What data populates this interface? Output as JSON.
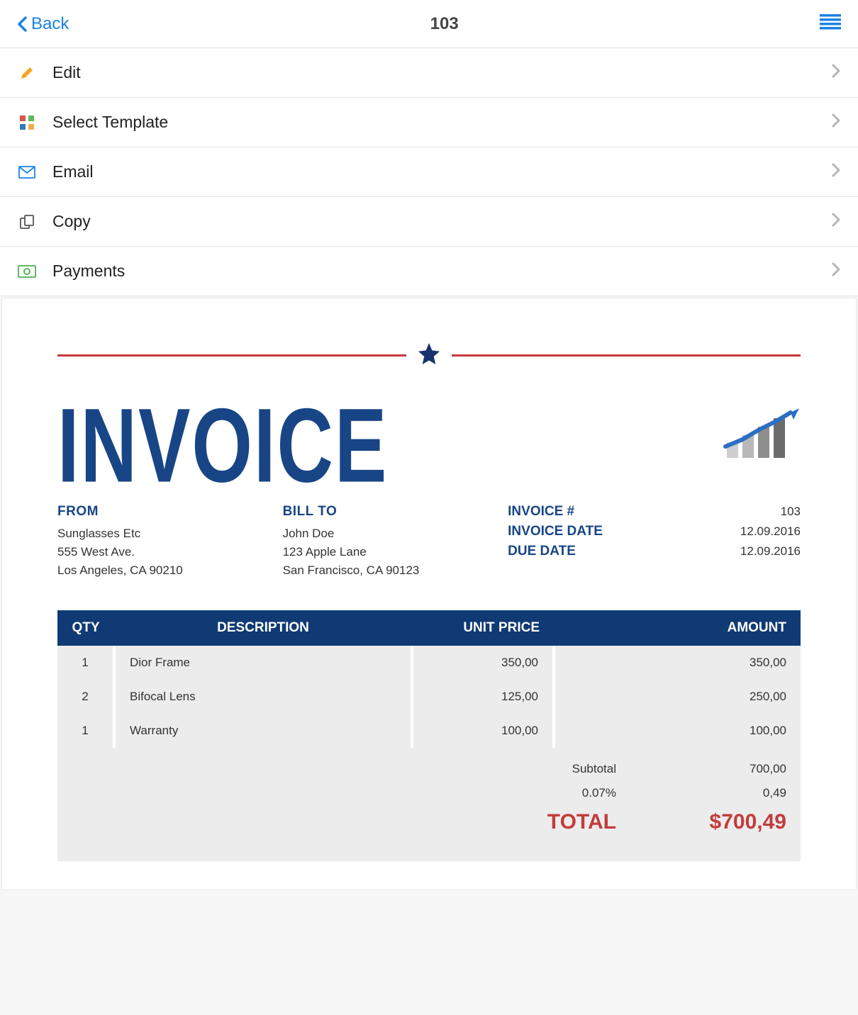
{
  "nav": {
    "back_label": "Back",
    "title": "103"
  },
  "actions": [
    {
      "id": "edit",
      "label": "Edit"
    },
    {
      "id": "template",
      "label": "Select Template"
    },
    {
      "id": "email",
      "label": "Email"
    },
    {
      "id": "copy",
      "label": "Copy"
    },
    {
      "id": "payments",
      "label": "Payments"
    }
  ],
  "invoice": {
    "heading": "INVOICE",
    "from_heading": "FROM",
    "from": {
      "name": "Sunglasses Etc",
      "street": "555 West Ave.",
      "city": "Los Angeles, CA 90210"
    },
    "billto_heading": "BILL TO",
    "billto": {
      "name": "John Doe",
      "street": "123 Apple Lane",
      "city": "San Francisco, CA 90123"
    },
    "meta": {
      "number_label": "INVOICE #",
      "number": "103",
      "date_label": "INVOICE DATE",
      "date": "12.09.2016",
      "due_label": "DUE DATE",
      "due": "12.09.2016"
    },
    "columns": {
      "qty": "QTY",
      "desc": "DESCRIPTION",
      "price": "UNIT PRICE",
      "amount": "AMOUNT"
    },
    "items": [
      {
        "qty": "1",
        "desc": "Dior Frame",
        "price": "350,00",
        "amount": "350,00"
      },
      {
        "qty": "2",
        "desc": "Bifocal Lens",
        "price": "125,00",
        "amount": "250,00"
      },
      {
        "qty": "1",
        "desc": "Warranty",
        "price": "100,00",
        "amount": "100,00"
      }
    ],
    "totals": {
      "subtotal_label": "Subtotal",
      "subtotal": "700,00",
      "tax_label": "0.07%",
      "tax": "0,49",
      "total_label": "TOTAL",
      "total": "$700,49"
    }
  },
  "colors": {
    "accent_blue": "#184586",
    "accent_red": "#c23b3b",
    "link_blue": "#1a82e6"
  }
}
